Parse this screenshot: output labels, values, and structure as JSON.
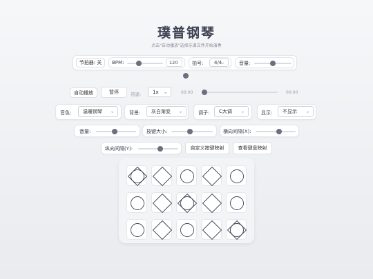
{
  "header": {
    "title": "璞普钢琴",
    "subtitle": "点击\"自动播放\"选择乐谱文件开始演奏"
  },
  "metronome": {
    "toggle_label": "节拍器: 关",
    "bpm_label": "BPM:",
    "bpm_value": "120",
    "bpm_level": 0.3,
    "beat_label": "拍号:",
    "beat_value": "4/4",
    "volume_label": "音量:",
    "volume_level": 0.5
  },
  "playback": {
    "auto_play_label": "自动播放",
    "pause_label": "暂停",
    "speed_label": "倍速:",
    "speed_value": "1x",
    "time_current": "00:00",
    "time_total": "00:00",
    "progress": 0
  },
  "settings": {
    "timbre_label": "音色:",
    "timbre_value": "温暖钢琴",
    "background_label": "背景:",
    "background_value": "灰白渐变",
    "key_label": "调子:",
    "key_value": "C大调",
    "display_label": "显示:",
    "display_value": "不显示"
  },
  "layout_controls": {
    "volume_label": "音量:",
    "volume_level": 0.45,
    "key_size_label": "按键大小:",
    "key_size_level": 0.45,
    "h_spacing_label": "横向间隔(X):",
    "h_spacing_level": 0.6,
    "v_spacing_label": "纵向间隔(Y):",
    "v_spacing_level": 0.55,
    "custom_mapping_label": "自定义按键映射",
    "view_mapping_label": "查看键盘映射"
  },
  "keyboard": {
    "rows": [
      [
        "circle-diamond",
        "diamond",
        "circle",
        "diamond",
        "circle"
      ],
      [
        "circle",
        "diamond",
        "circle-diamond",
        "diamond",
        "circle"
      ],
      [
        "circle",
        "diamond",
        "circle",
        "diamond",
        "circle-diamond"
      ]
    ]
  },
  "colors": {
    "accent": "#6b6f80",
    "symbol_stroke": "#3d4252"
  }
}
